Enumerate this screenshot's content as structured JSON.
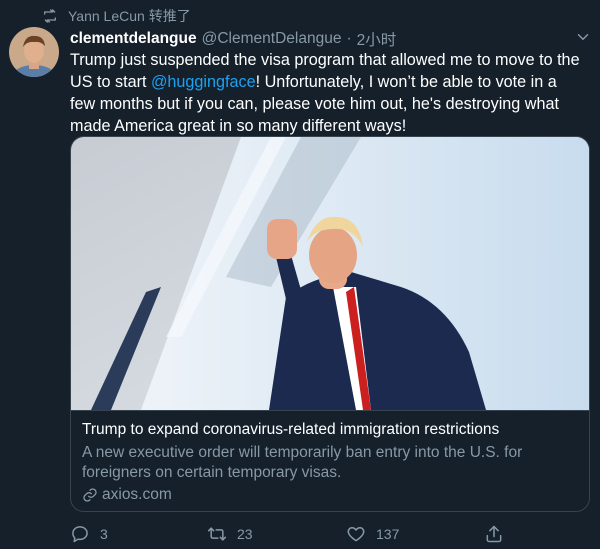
{
  "retweet_banner": {
    "icon": "retweet-icon",
    "text": "Yann LeCun 转推了"
  },
  "tweet": {
    "author_name": "clementdelangue",
    "handle": "@ClementDelangue",
    "separator": "·",
    "time": "2小时",
    "text_before": "Trump just suspended the visa program that allowed me to move to the US to start ",
    "mention": "@huggingface",
    "text_after": "! Unfortunately, I won’t be able to vote in a few months but if you can, please vote him out, he's destroying what made America great in so many different ways!"
  },
  "card": {
    "title": "Trump to expand coronavirus-related immigration restrictions",
    "description": "A new executive order will temporarily ban entry into the U.S. for foreigners on certain temporary visas.",
    "domain": "axios.com"
  },
  "actions": {
    "reply_count": "3",
    "retweet_count": "23",
    "like_count": "137"
  },
  "colors": {
    "background": "#15202b",
    "secondary_text": "#8899a6",
    "link": "#1da1f2",
    "border": "#38444d"
  }
}
